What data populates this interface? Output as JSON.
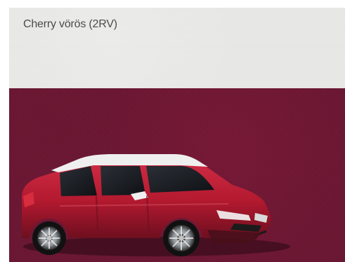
{
  "paint_option": {
    "color_name": "Cherry vörös (2RV)",
    "swatch_color": "#6a1330",
    "car_body_color": "#b3192f",
    "car_roof_color": "#efefef"
  }
}
